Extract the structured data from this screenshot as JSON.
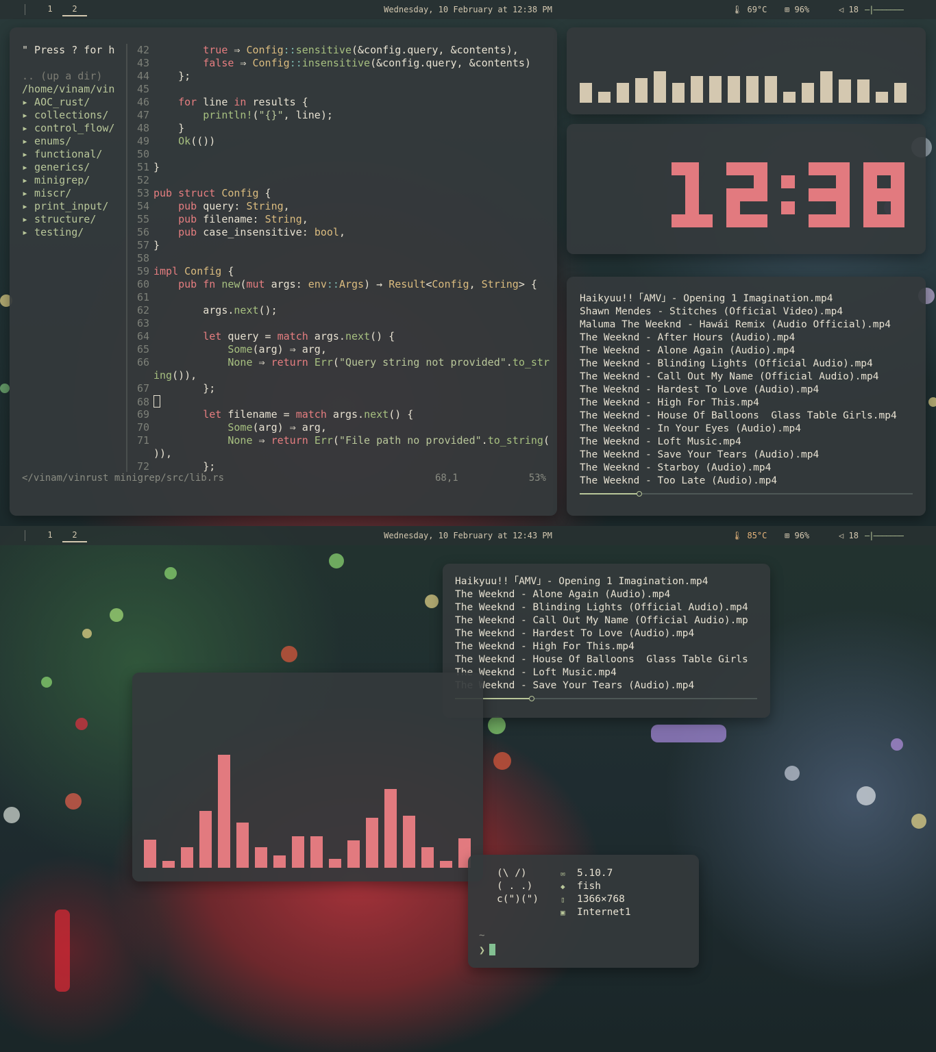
{
  "screen1": {
    "bar": {
      "workspaces": [
        "1",
        "2"
      ],
      "datetime": "Wednesday, 10 February at 12:38 PM",
      "temperature": "69°C",
      "battery": "96%",
      "volume": "18",
      "volume_bar": "—|———————"
    },
    "editor": {
      "tree": {
        "header": "\" Press ? for h",
        "up_dir": ".. (up a dir)",
        "path": "/home/vinam/vin",
        "items": [
          "▸ AOC_rust/",
          "▸ collections/",
          "▸ control_flow/",
          "▸ enums/",
          "▸ functional/",
          "▸ generics/",
          "▸ minigrep/",
          "▸ miscr/",
          "▸ print_input/",
          "▸ structure/",
          "▸ testing/"
        ]
      },
      "status": {
        "file": "</vinam/vinrust minigrep/src/lib.rs",
        "position": "68,1",
        "percent": "53%"
      }
    },
    "visualizer_levels": [
      0.42,
      0.23,
      0.42,
      0.52,
      0.65,
      0.42,
      0.56,
      0.56,
      0.56,
      0.56,
      0.56,
      0.23,
      0.42,
      0.65,
      0.48,
      0.48,
      0.23,
      0.42
    ],
    "clock": "12:38",
    "playlist": {
      "tracks": [
        "Haikyuu!!「AMV」- Opening 1 Imagination.mp4",
        "Shawn Mendes - Stitches (Official Video).mp4",
        "Maluma The Weeknd - Hawái Remix (Audio Official).mp4",
        "The Weeknd - After Hours (Audio).mp4",
        "The Weeknd - Alone Again (Audio).mp4",
        "The Weeknd - Blinding Lights (Official Audio).mp4",
        "The Weeknd - Call Out My Name (Official Audio).mp4",
        "The Weeknd - Hardest To Love (Audio).mp4",
        "The Weeknd - High For This.mp4",
        "The Weeknd - House Of Balloons  Glass Table Girls.mp4",
        "The Weeknd - In Your Eyes (Audio).mp4",
        "The Weeknd - Loft Music.mp4",
        "The Weeknd - Save Your Tears (Audio).mp4",
        "The Weeknd - Starboy (Audio).mp4",
        "The Weeknd - Too Late (Audio).mp4"
      ],
      "progress": 0.18
    }
  },
  "screen2": {
    "bar": {
      "workspaces": [
        "1",
        "2"
      ],
      "datetime": "Wednesday, 10 February at 12:43 PM",
      "temperature": "85°C",
      "battery": "96%",
      "volume": "18",
      "volume_bar": "—|———————"
    },
    "playlist": {
      "tracks": [
        "Haikyuu!!「AMV」- Opening 1 Imagination.mp4",
        "The Weeknd - Alone Again (Audio).mp4",
        "The Weeknd - Blinding Lights (Official Audio).mp4",
        "The Weeknd - Call Out My Name (Official Audio).mp",
        "The Weeknd - Hardest To Love (Audio).mp4",
        "The Weeknd - High For This.mp4",
        "The Weeknd - House Of Balloons  Glass Table Girls",
        "The Weeknd - Loft Music.mp4",
        "The Weeknd - Save Your Tears (Audio).mp4"
      ],
      "progress": 0.255
    },
    "visualizer_levels": [
      0.25,
      0.06,
      0.18,
      0.5,
      1.0,
      0.4,
      0.18,
      0.11,
      0.28,
      0.28,
      0.08,
      0.24,
      0.44,
      0.7,
      0.46,
      0.18,
      0.06,
      0.26
    ],
    "terminal": {
      "ascii": [
        "(\\ /)",
        "( . .)",
        "c(\")(\")"
      ],
      "info": [
        "5.10.7",
        "fish",
        "1366×768",
        "Internet1"
      ],
      "info_icons": [
        "mail-icon",
        "diamond-icon",
        "doc-icon",
        "network-icon"
      ],
      "tilde": "~",
      "prompt": "❯"
    }
  },
  "colors": {
    "accent_green": "#b9c79a",
    "bar_beige": "#d4c8b0",
    "pink": "#e27a7f",
    "panel": "#343a3c"
  }
}
